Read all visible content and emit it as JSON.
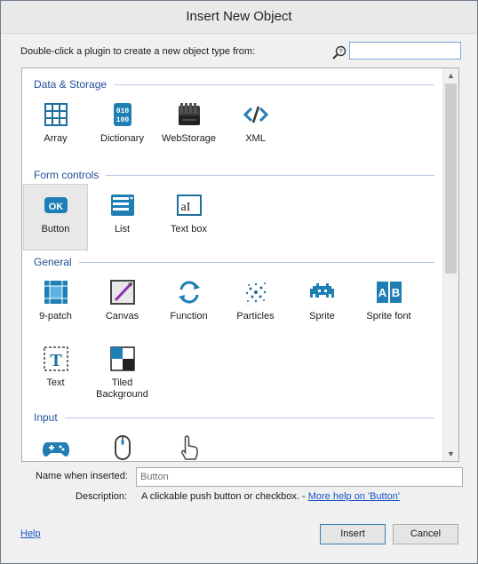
{
  "dialog": {
    "title": "Insert New Object",
    "prompt": "Double-click a plugin to create a new object type from:",
    "search": {
      "value": "",
      "placeholder": ""
    }
  },
  "sections": [
    {
      "title": "Data & Storage",
      "items": [
        {
          "label": "Array",
          "icon": "array-icon"
        },
        {
          "label": "Dictionary",
          "icon": "dictionary-icon"
        },
        {
          "label": "WebStorage",
          "icon": "webstorage-icon"
        },
        {
          "label": "XML",
          "icon": "xml-icon"
        }
      ]
    },
    {
      "title": "Form controls",
      "items": [
        {
          "label": "Button",
          "icon": "button-icon",
          "selected": true
        },
        {
          "label": "List",
          "icon": "list-icon"
        },
        {
          "label": "Text box",
          "icon": "textbox-icon"
        }
      ]
    },
    {
      "title": "General",
      "items": [
        {
          "label": "9-patch",
          "icon": "ninepatch-icon"
        },
        {
          "label": "Canvas",
          "icon": "canvas-icon"
        },
        {
          "label": "Function",
          "icon": "function-icon"
        },
        {
          "label": "Particles",
          "icon": "particles-icon"
        },
        {
          "label": "Sprite",
          "icon": "sprite-icon"
        },
        {
          "label": "Sprite font",
          "icon": "spritefont-icon"
        },
        {
          "label": "Text",
          "icon": "text-icon"
        },
        {
          "label": "Tiled Background",
          "icon": "tiledbackground-icon"
        }
      ]
    },
    {
      "title": "Input",
      "items": [
        {
          "label": "Gamepad",
          "icon": "gamepad-icon"
        },
        {
          "label": "Mouse",
          "icon": "mouse-icon"
        },
        {
          "label": "Touch",
          "icon": "touch-icon"
        }
      ]
    }
  ],
  "footer": {
    "name_label": "Name when inserted:",
    "name_value": "Button",
    "description_label": "Description:",
    "description_text": "A clickable push button or checkbox. - ",
    "description_link": "More help on 'Button'",
    "help_link": "Help",
    "insert_label": "Insert",
    "cancel_label": "Cancel"
  },
  "colors": {
    "accent": "#1f4f98",
    "icon_blue": "#1f7fb4",
    "link": "#1a55c4"
  }
}
